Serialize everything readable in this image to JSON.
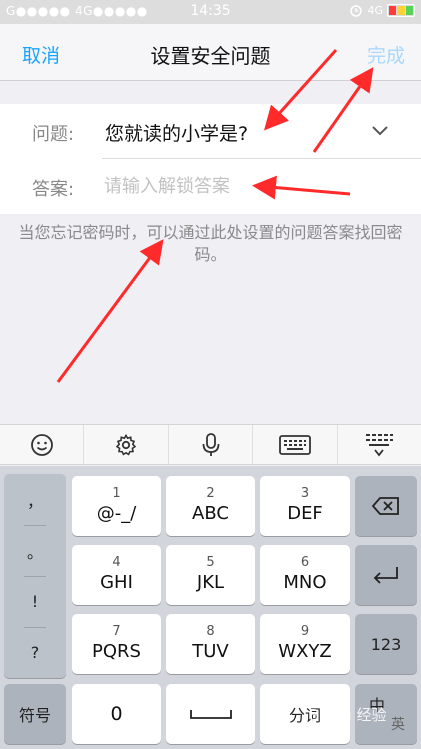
{
  "status_bar": {
    "carrier": "G●●●●● 4G●●●●●",
    "time": "14:35",
    "network": "4G",
    "battery_colors": [
      "#ff3b3b",
      "#ffd23b",
      "#57d357"
    ]
  },
  "nav": {
    "cancel": "取消",
    "title": "设置安全问题",
    "done": "完成"
  },
  "form": {
    "question_label": "问题:",
    "question_value": "您就读的小学是?",
    "answer_label": "答案:",
    "answer_placeholder": "请输入解锁答案",
    "answer_value": ""
  },
  "hint": "当您忘记密码时，可以通过此处设置的问题答案找回密码。",
  "toolbar": {
    "icons": [
      "emoji-icon",
      "gear-icon",
      "microphone-icon",
      "keyboard-icon",
      "collapse-keyboard-icon"
    ]
  },
  "keyboard": {
    "symbols": [
      "，",
      "。",
      "!",
      "?"
    ],
    "keys": [
      {
        "num": "1",
        "letters": "@-_/"
      },
      {
        "num": "2",
        "letters": "ABC"
      },
      {
        "num": "3",
        "letters": "DEF"
      },
      {
        "num": "4",
        "letters": "GHI"
      },
      {
        "num": "5",
        "letters": "JKL"
      },
      {
        "num": "6",
        "letters": "MNO"
      },
      {
        "num": "7",
        "letters": "PQRS"
      },
      {
        "num": "8",
        "letters": "TUV"
      },
      {
        "num": "9",
        "letters": "WXYZ"
      }
    ],
    "symbols_switch": "符号",
    "zero": "0",
    "segment": "分词",
    "num_switch": "123",
    "lang_switch": "中",
    "lang_alt": "英"
  },
  "watermark": "Baidu 经验",
  "colors": {
    "accent": "#1aa4ff",
    "done_disabled": "#a9d8fb",
    "arrow": "#ff2a2a"
  }
}
